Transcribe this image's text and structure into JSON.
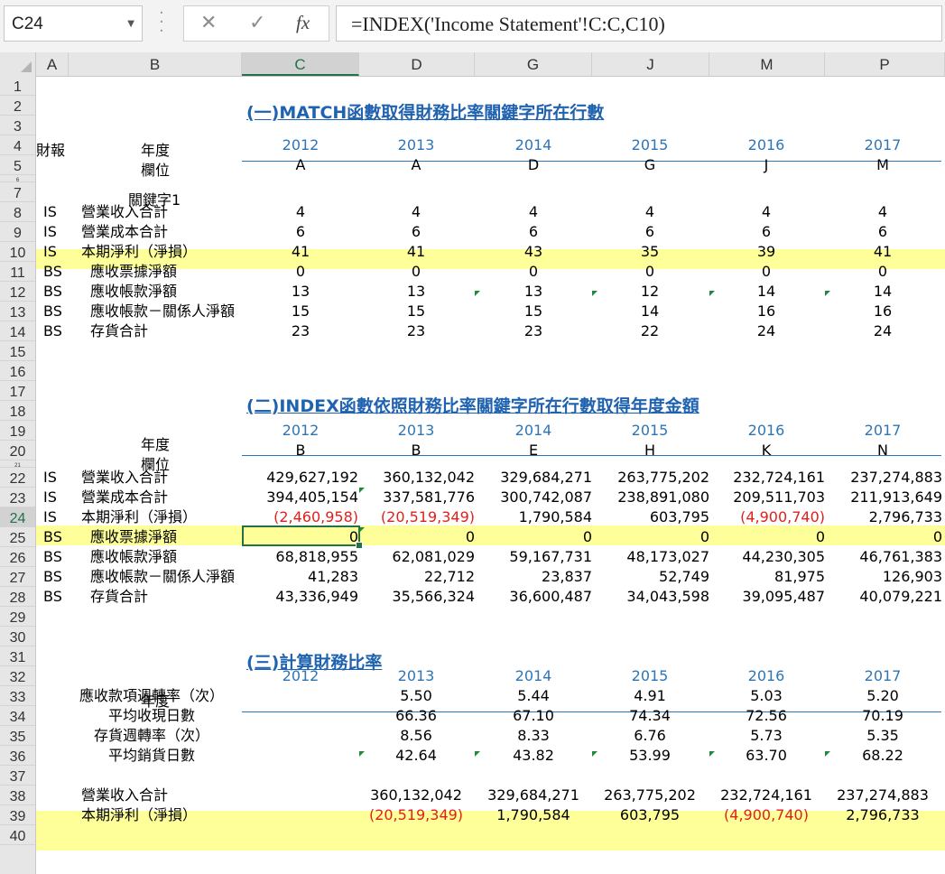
{
  "formula_bar": {
    "name_box": "C24",
    "cancel_icon": "✕",
    "enter_icon": "✓",
    "fx_label": "fx",
    "formula": "=INDEX('Income Statement'!C:C,C10)"
  },
  "columns": [
    "A",
    "B",
    "C",
    "D",
    "G",
    "J",
    "M",
    "P"
  ],
  "rows": [
    "1",
    "2",
    "3",
    "4",
    "5",
    "6",
    "7",
    "8",
    "9",
    "10",
    "11",
    "12",
    "13",
    "14",
    "15",
    "16",
    "17",
    "18",
    "19",
    "20",
    "21",
    "22",
    "23",
    "24",
    "25",
    "26",
    "27",
    "28",
    "29",
    "30",
    "31",
    "32",
    "33",
    "34",
    "35",
    "36",
    "37",
    "38",
    "39",
    "40"
  ],
  "selected_cell": "C24",
  "colors": {
    "highlight": "#ffff99",
    "accent": "#217346",
    "title": "#1f62b0",
    "year": "#2e75b6",
    "negative": "#e0201b"
  },
  "section1": {
    "title": "(一)MATCH函數取得財務比率關鍵字所在行數",
    "report_label": "財報",
    "year_label": "年度",
    "field_label": "欄位",
    "keyword_label": "關鍵字1",
    "years": [
      "2012",
      "2013",
      "2014",
      "2015",
      "2016",
      "2017"
    ],
    "cols": [
      "A",
      "A",
      "D",
      "G",
      "J",
      "M"
    ],
    "rows": [
      {
        "type": "IS",
        "name": "營業收入合計",
        "values": [
          "4",
          "4",
          "4",
          "4",
          "4",
          "4"
        ]
      },
      {
        "type": "IS",
        "name": "營業成本合計",
        "values": [
          "6",
          "6",
          "6",
          "6",
          "6",
          "6"
        ]
      },
      {
        "type": "IS",
        "name": "本期淨利（淨損）",
        "values": [
          "41",
          "41",
          "43",
          "35",
          "39",
          "41"
        ]
      },
      {
        "type": "BS",
        "name": "應收票據淨額",
        "values": [
          "0",
          "0",
          "0",
          "0",
          "0",
          "0"
        ]
      },
      {
        "type": "BS",
        "name": "應收帳款淨額",
        "values": [
          "13",
          "13",
          "13",
          "12",
          "14",
          "14"
        ]
      },
      {
        "type": "BS",
        "name": "應收帳款－關係人淨額",
        "values": [
          "15",
          "15",
          "15",
          "14",
          "16",
          "16"
        ]
      },
      {
        "type": "BS",
        "name": "存貨合計",
        "values": [
          "23",
          "23",
          "23",
          "22",
          "24",
          "24"
        ]
      }
    ]
  },
  "section2": {
    "title": "(二)INDEX函數依照財務比率關鍵字所在行數取得年度金額",
    "year_label": "年度",
    "field_label": "欄位",
    "years": [
      "2012",
      "2013",
      "2014",
      "2015",
      "2016",
      "2017"
    ],
    "cols": [
      "B",
      "B",
      "E",
      "H",
      "K",
      "N"
    ],
    "rows": [
      {
        "type": "IS",
        "name": "營業收入合計",
        "values": [
          "429,627,192",
          "360,132,042",
          "329,684,271",
          "263,775,202",
          "232,724,161",
          "237,274,883"
        ]
      },
      {
        "type": "IS",
        "name": "營業成本合計",
        "values": [
          "394,405,154",
          "337,581,776",
          "300,742,087",
          "238,891,080",
          "209,511,703",
          "211,913,649"
        ]
      },
      {
        "type": "IS",
        "name": "本期淨利（淨損）",
        "values": [
          "(2,460,958)",
          "(20,519,349)",
          "1,790,584",
          "603,795",
          "(4,900,740)",
          "2,796,733"
        ]
      },
      {
        "type": "BS",
        "name": "應收票據淨額",
        "values": [
          "0",
          "0",
          "0",
          "0",
          "0",
          "0"
        ]
      },
      {
        "type": "BS",
        "name": "應收帳款淨額",
        "values": [
          "68,818,955",
          "62,081,029",
          "59,167,731",
          "48,173,027",
          "44,230,305",
          "46,761,383"
        ]
      },
      {
        "type": "BS",
        "name": "應收帳款－關係人淨額",
        "values": [
          "41,283",
          "22,712",
          "23,837",
          "52,749",
          "81,975",
          "126,903"
        ]
      },
      {
        "type": "BS",
        "name": "存貨合計",
        "values": [
          "43,336,949",
          "35,566,324",
          "36,600,487",
          "34,043,598",
          "39,095,487",
          "40,079,221"
        ]
      }
    ]
  },
  "section3": {
    "title": "(三)計算財務比率",
    "year_label": "年度",
    "years": [
      "2012",
      "2013",
      "2014",
      "2015",
      "2016",
      "2017"
    ],
    "ratios": [
      {
        "name": "應收款項週轉率（次）",
        "values": [
          "",
          "5.50",
          "5.44",
          "4.91",
          "5.03",
          "5.20"
        ]
      },
      {
        "name": "平均收現日數",
        "values": [
          "",
          "66.36",
          "67.10",
          "74.34",
          "72.56",
          "70.19"
        ]
      },
      {
        "name": "存貨週轉率（次）",
        "values": [
          "",
          "8.56",
          "8.33",
          "6.76",
          "5.73",
          "5.35"
        ]
      },
      {
        "name": "平均銷貨日數",
        "values": [
          "",
          "42.64",
          "43.82",
          "53.99",
          "63.70",
          "68.22"
        ]
      }
    ],
    "summary": [
      {
        "name": "營業收入合計",
        "values": [
          "",
          "360,132,042",
          "329,684,271",
          "263,775,202",
          "232,724,161",
          "237,274,883"
        ]
      },
      {
        "name": "本期淨利（淨損）",
        "values": [
          "",
          "(20,519,349)",
          "1,790,584",
          "603,795",
          "(4,900,740)",
          "2,796,733"
        ]
      }
    ]
  }
}
